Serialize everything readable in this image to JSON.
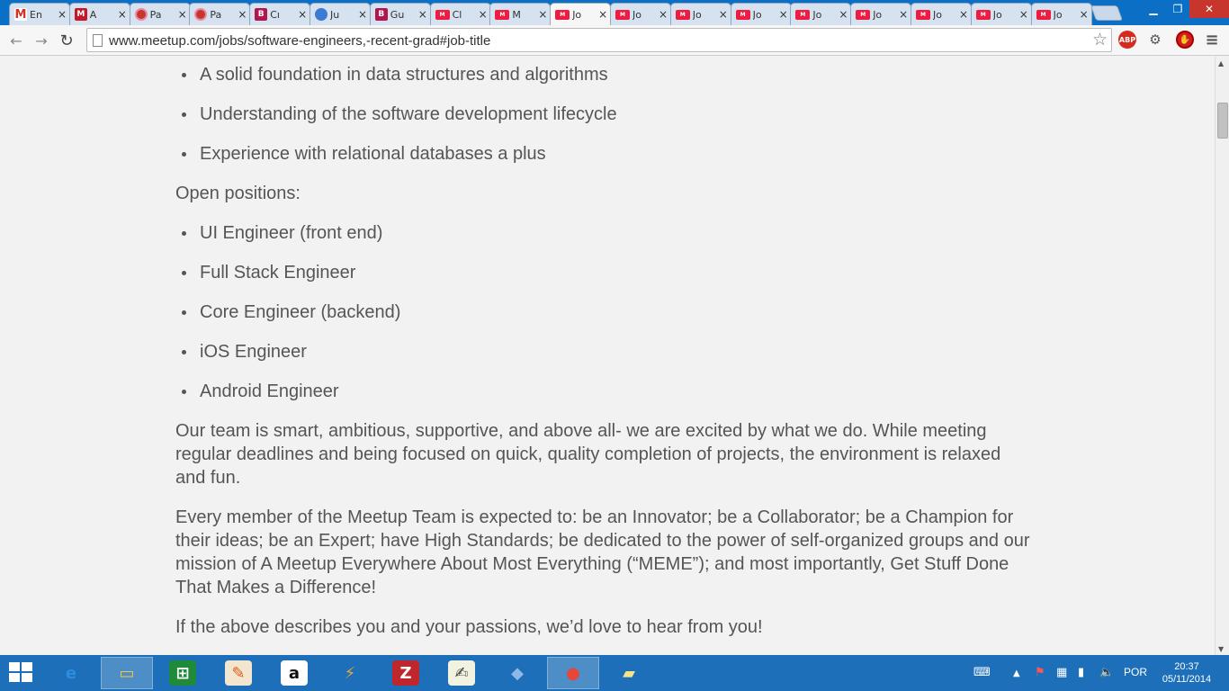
{
  "browser": {
    "tabs": [
      {
        "title": "En",
        "icon": "gmail-icon"
      },
      {
        "title": "A",
        "icon": "m-icon"
      },
      {
        "title": "Pa",
        "icon": "circle-icon"
      },
      {
        "title": "Pa",
        "icon": "circle-icon"
      },
      {
        "title": "Cı",
        "icon": "b-icon"
      },
      {
        "title": "Ju",
        "icon": "globe-icon"
      },
      {
        "title": "Gu",
        "icon": "b-icon"
      },
      {
        "title": "Cl",
        "icon": "meetup-icon"
      },
      {
        "title": "M",
        "icon": "meetup-icon"
      },
      {
        "title": "Jo",
        "icon": "meetup-icon",
        "active": true
      },
      {
        "title": "Jo",
        "icon": "meetup-icon"
      },
      {
        "title": "Jo",
        "icon": "meetup-icon"
      },
      {
        "title": "Jo",
        "icon": "meetup-icon"
      },
      {
        "title": "Jo",
        "icon": "meetup-icon"
      },
      {
        "title": "Jo",
        "icon": "meetup-icon"
      },
      {
        "title": "Jo",
        "icon": "meetup-icon"
      },
      {
        "title": "Jo",
        "icon": "meetup-icon"
      },
      {
        "title": "Jo",
        "icon": "meetup-icon"
      }
    ],
    "url": "www.meetup.com/jobs/software-engineers,-recent-grad#job-title",
    "abp_label": "ABP"
  },
  "article": {
    "skills": [
      "A solid foundation in data structures and algorithms",
      "Understanding of the software development lifecycle",
      "Experience with relational databases a plus"
    ],
    "positions_heading": "Open positions:",
    "positions": [
      "UI Engineer (front end)",
      "Full Stack Engineer",
      "Core Engineer (backend)",
      "iOS Engineer",
      "Android Engineer"
    ],
    "team_paragraph": "Our team is smart, ambitious, supportive, and above all- we are excited by what we do. While meeting regular deadlines and being focused on quick, quality completion of projects, the environment is relaxed and fun.",
    "expectations_paragraph": "Every member of the Meetup Team is expected to: be an Innovator; be a Collaborator; be a Champion for their ideas; be an Expert; have High Standards; be dedicated to the power of self-organized groups and our mission of A Meetup Everywhere About Most Everything (“MEME”); and most importantly, Get Stuff Done That Makes a Difference!",
    "closing_paragraph": "If the above describes you and your passions, we’d love to hear from you!"
  },
  "taskbar": {
    "apps": [
      {
        "name": "internet-explorer-icon",
        "open": false
      },
      {
        "name": "file-explorer-icon",
        "open": true
      },
      {
        "name": "excel-icon",
        "open": false
      },
      {
        "name": "paint-icon",
        "open": false
      },
      {
        "name": "amazon-icon",
        "open": false
      },
      {
        "name": "winamp-icon",
        "open": false
      },
      {
        "name": "filezilla-icon",
        "open": false
      },
      {
        "name": "notepad-icon",
        "open": false
      },
      {
        "name": "virtualbox-icon",
        "open": false
      },
      {
        "name": "chrome-icon",
        "open": true
      },
      {
        "name": "sticky-notes-icon",
        "open": false
      }
    ],
    "language": "POR",
    "time": "20:37",
    "date": "05/11/2014"
  },
  "colors": {
    "tabbar": "#0b6fc6",
    "taskbar": "#1c6fb8",
    "page_background": "#f2f2f2",
    "text": "#555555",
    "meetup_red": "#ed1c40"
  }
}
